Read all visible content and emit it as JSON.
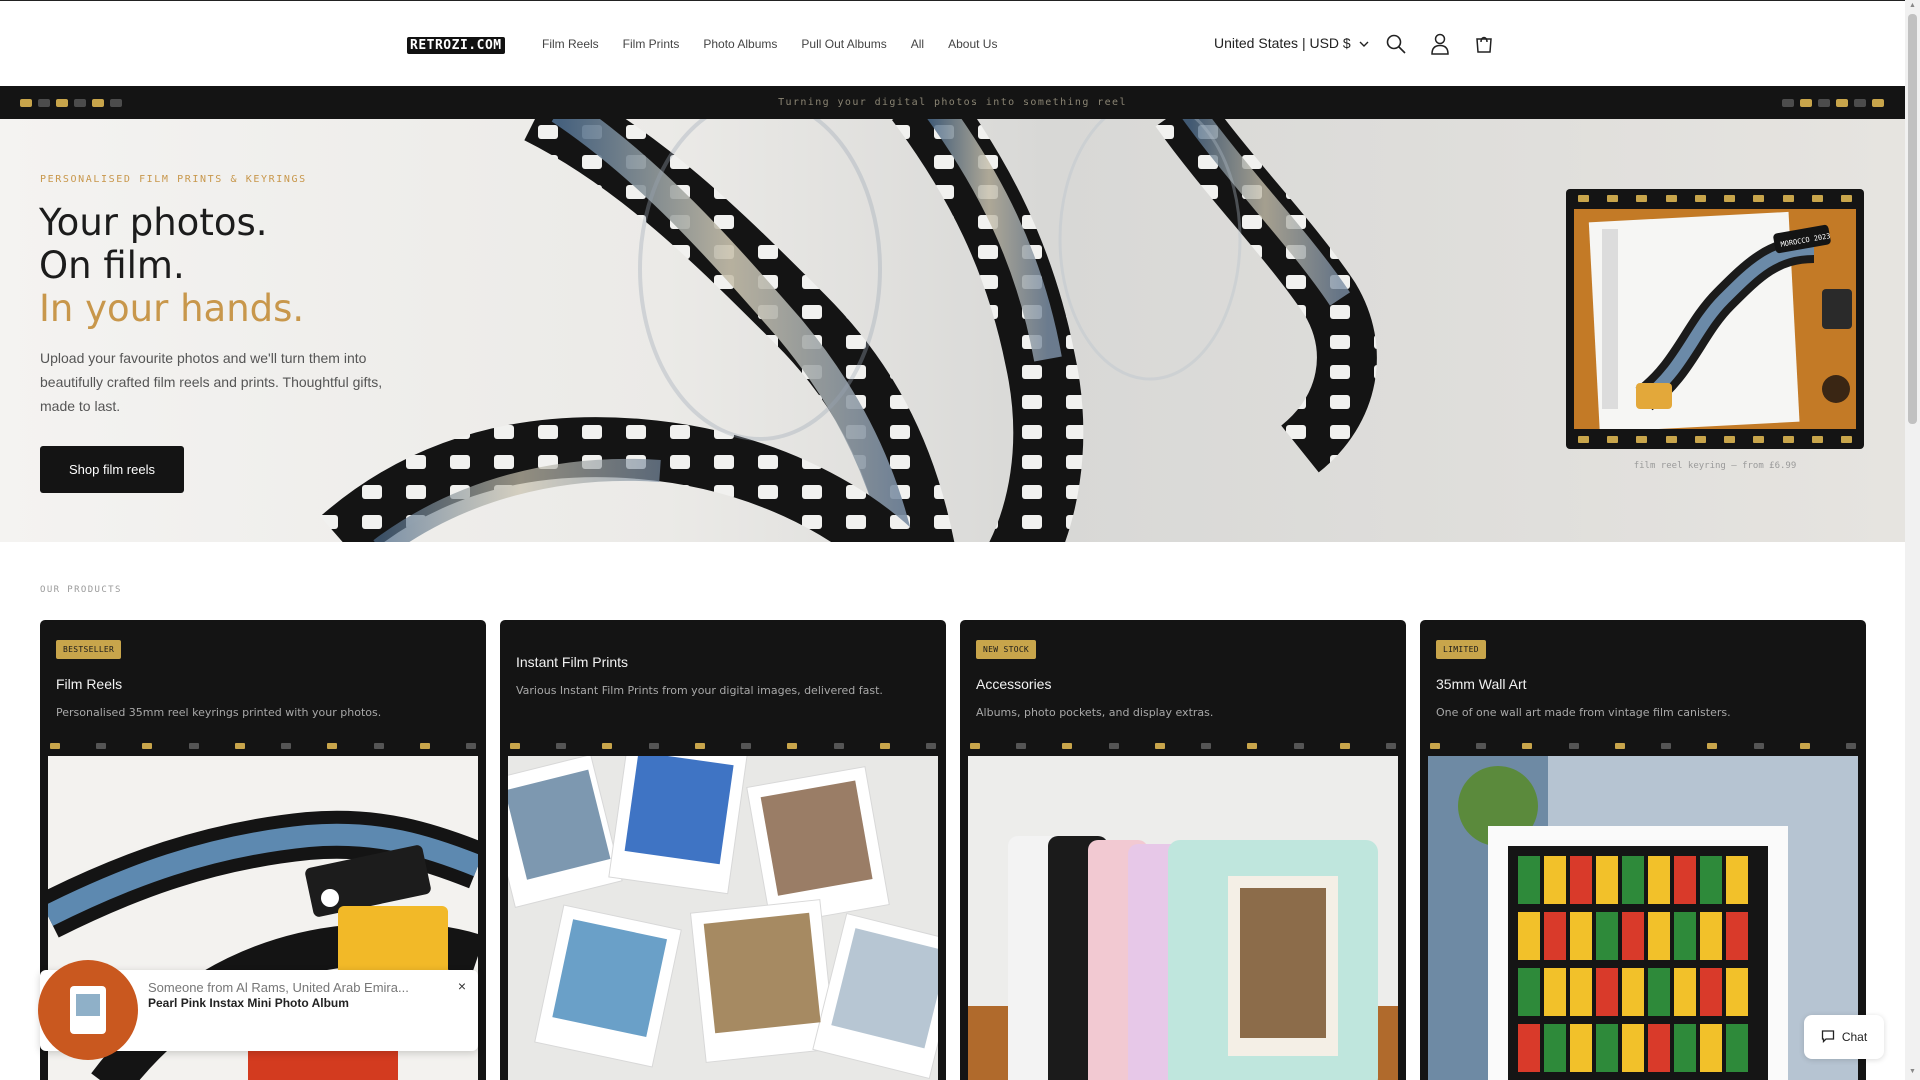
{
  "header": {
    "logo": "RETROZI.COM",
    "nav": [
      "Film Reels",
      "Film Prints",
      "Photo Albums",
      "Pull Out Albums",
      "All",
      "About Us"
    ],
    "currency": "United States | USD $"
  },
  "announcement": {
    "text": "Turning your digital photos into something reel"
  },
  "hero": {
    "eyebrow": "PERSONALISED FILM PRINTS & KEYRINGS",
    "title_line1": "Your photos.",
    "title_line2": "On film.",
    "title_line3": "In your hands.",
    "body": "Upload your favourite photos and we'll turn them into beautifully crafted film reels and prints. Thoughtful gifts, made to last.",
    "button": "Shop film reels",
    "frame_caption": "film reel keyring — from £6.99",
    "frame_tag": "MOROCCO 2023"
  },
  "products": {
    "label": "OUR PRODUCTS",
    "cards": [
      {
        "badge": "BESTSELLER",
        "title": "Film Reels",
        "desc": "Personalised 35mm reel keyrings printed with your photos."
      },
      {
        "badge": "",
        "title": "Instant Film Prints",
        "desc": "Various Instant Film Prints from your digital images, delivered fast."
      },
      {
        "badge": "NEW STOCK",
        "title": "Accessories",
        "desc": "Albums, photo pockets, and display extras."
      },
      {
        "badge": "LIMITED",
        "title": "35mm Wall Art",
        "desc": "One of one wall art made from vintage film canisters."
      }
    ]
  },
  "popup": {
    "line1": "Someone from Al Rams, United Arab Emira...",
    "line2": "Pearl Pink Instax Mini Photo Album",
    "close": "×"
  },
  "chat": {
    "label": "Chat"
  },
  "colors": {
    "accent": "#c8974b",
    "dark": "#141414",
    "gold": "#c8a54b"
  }
}
